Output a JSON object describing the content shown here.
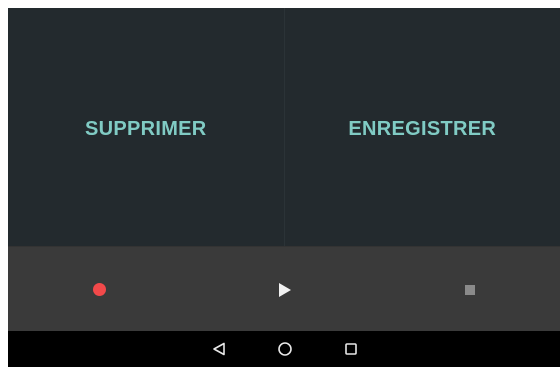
{
  "actions": {
    "delete_label": "SUPPRIMER",
    "save_label": "ENREGISTRER"
  },
  "player": {
    "record_icon": "record-icon",
    "play_icon": "play-icon",
    "stop_icon": "stop-icon"
  },
  "navbar": {
    "back_icon": "back-icon",
    "home_icon": "home-icon",
    "recents_icon": "recents-icon"
  },
  "colors": {
    "accent": "#80cbc4",
    "record": "#f2494a",
    "background": "#232a2e",
    "player_bar": "#3a3a3a",
    "navbar": "#000000"
  }
}
